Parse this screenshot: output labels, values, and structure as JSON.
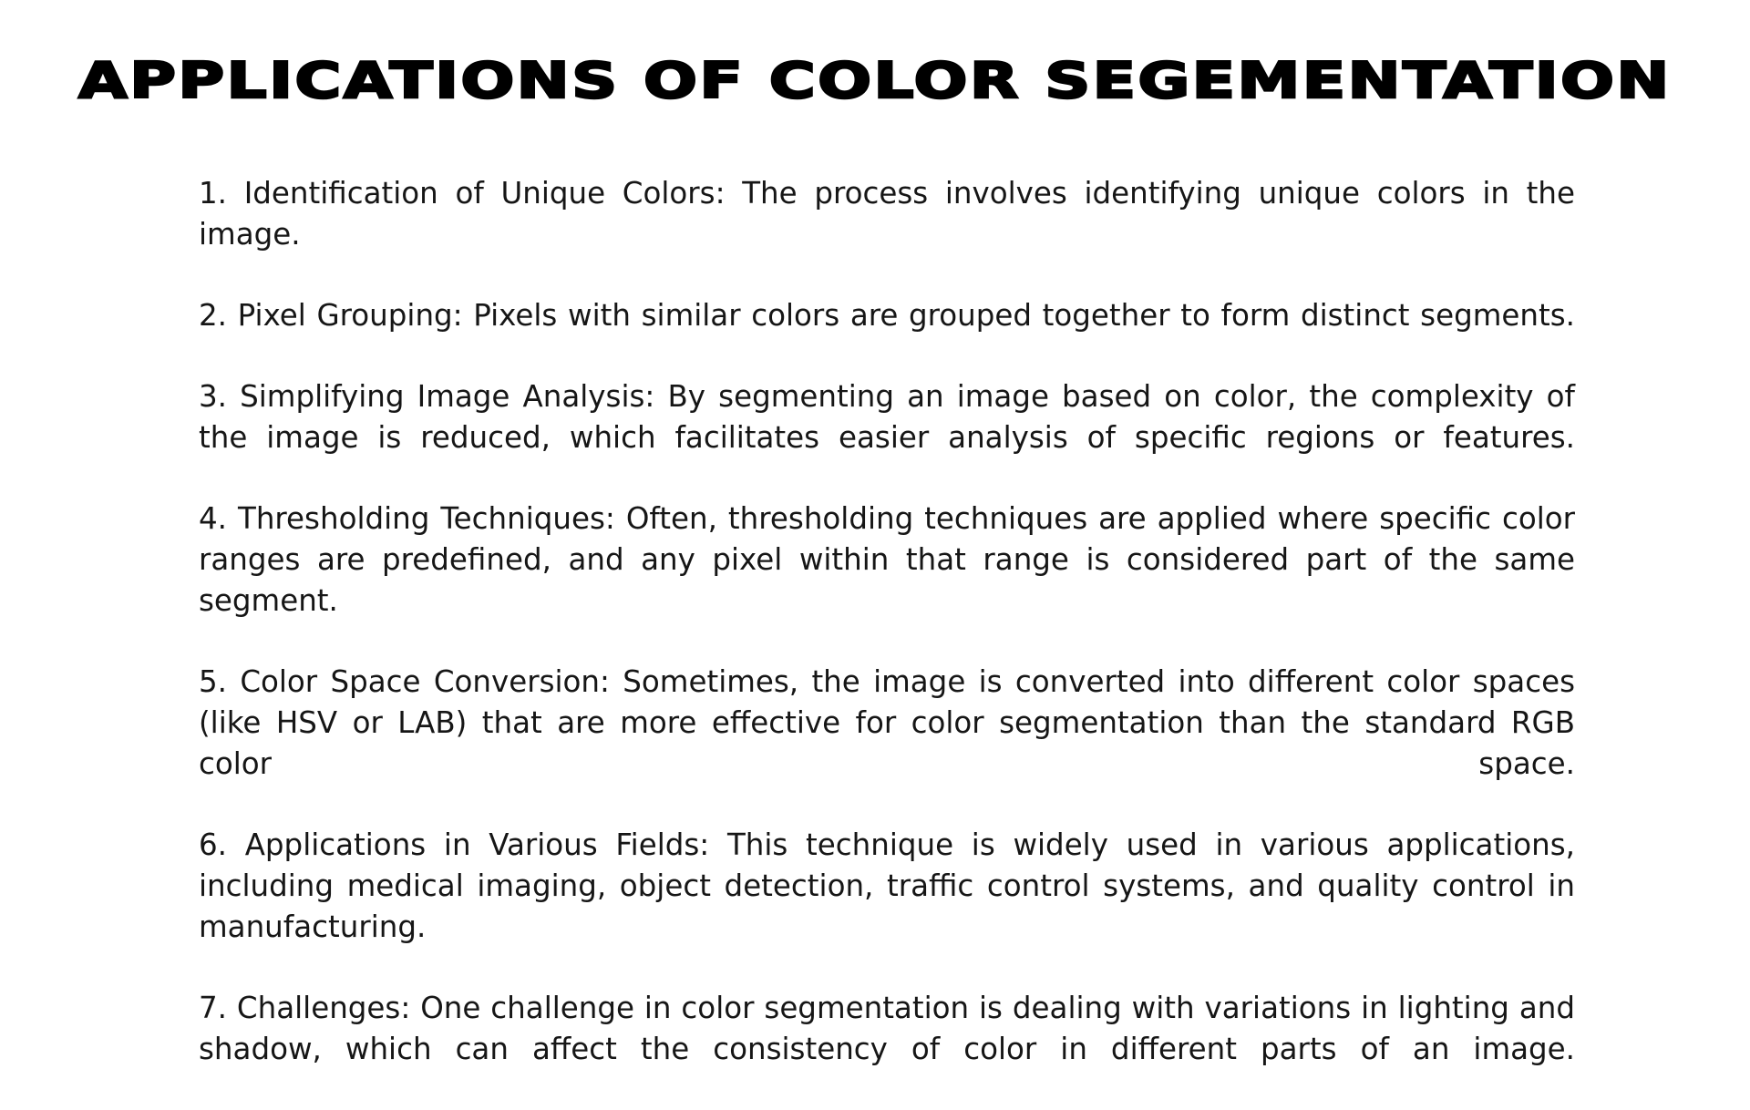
{
  "title": "APPLICATIONS OF COLOR SEGEMENTATION",
  "points": [
    "1. Identification of Unique Colors: The process involves identifying unique colors in the image.",
    "2. Pixel Grouping: Pixels with similar colors are grouped together to form distinct segments.",
    "3. Simplifying Image Analysis: By segmenting an image based on color, the complexity of the image is reduced, which facilitates easier analysis of specific regions or features.",
    "4. Thresholding Techniques: Often, thresholding techniques are applied where specific color ranges are predefined, and any pixel within that range is considered part of the same segment.",
    "5. Color Space Conversion: Sometimes, the image is converted into different color spaces (like HSV or LAB) that are more effective for color segmentation than the standard RGB color space.",
    "6. Applications in Various Fields: This technique is widely used in various applications, including medical imaging, object detection, traffic control systems, and quality control in manufacturing.",
    "7. Challenges: One challenge in color segmentation is dealing with variations in lighting and shadow, which can affect the consistency of color in different parts of an image."
  ]
}
